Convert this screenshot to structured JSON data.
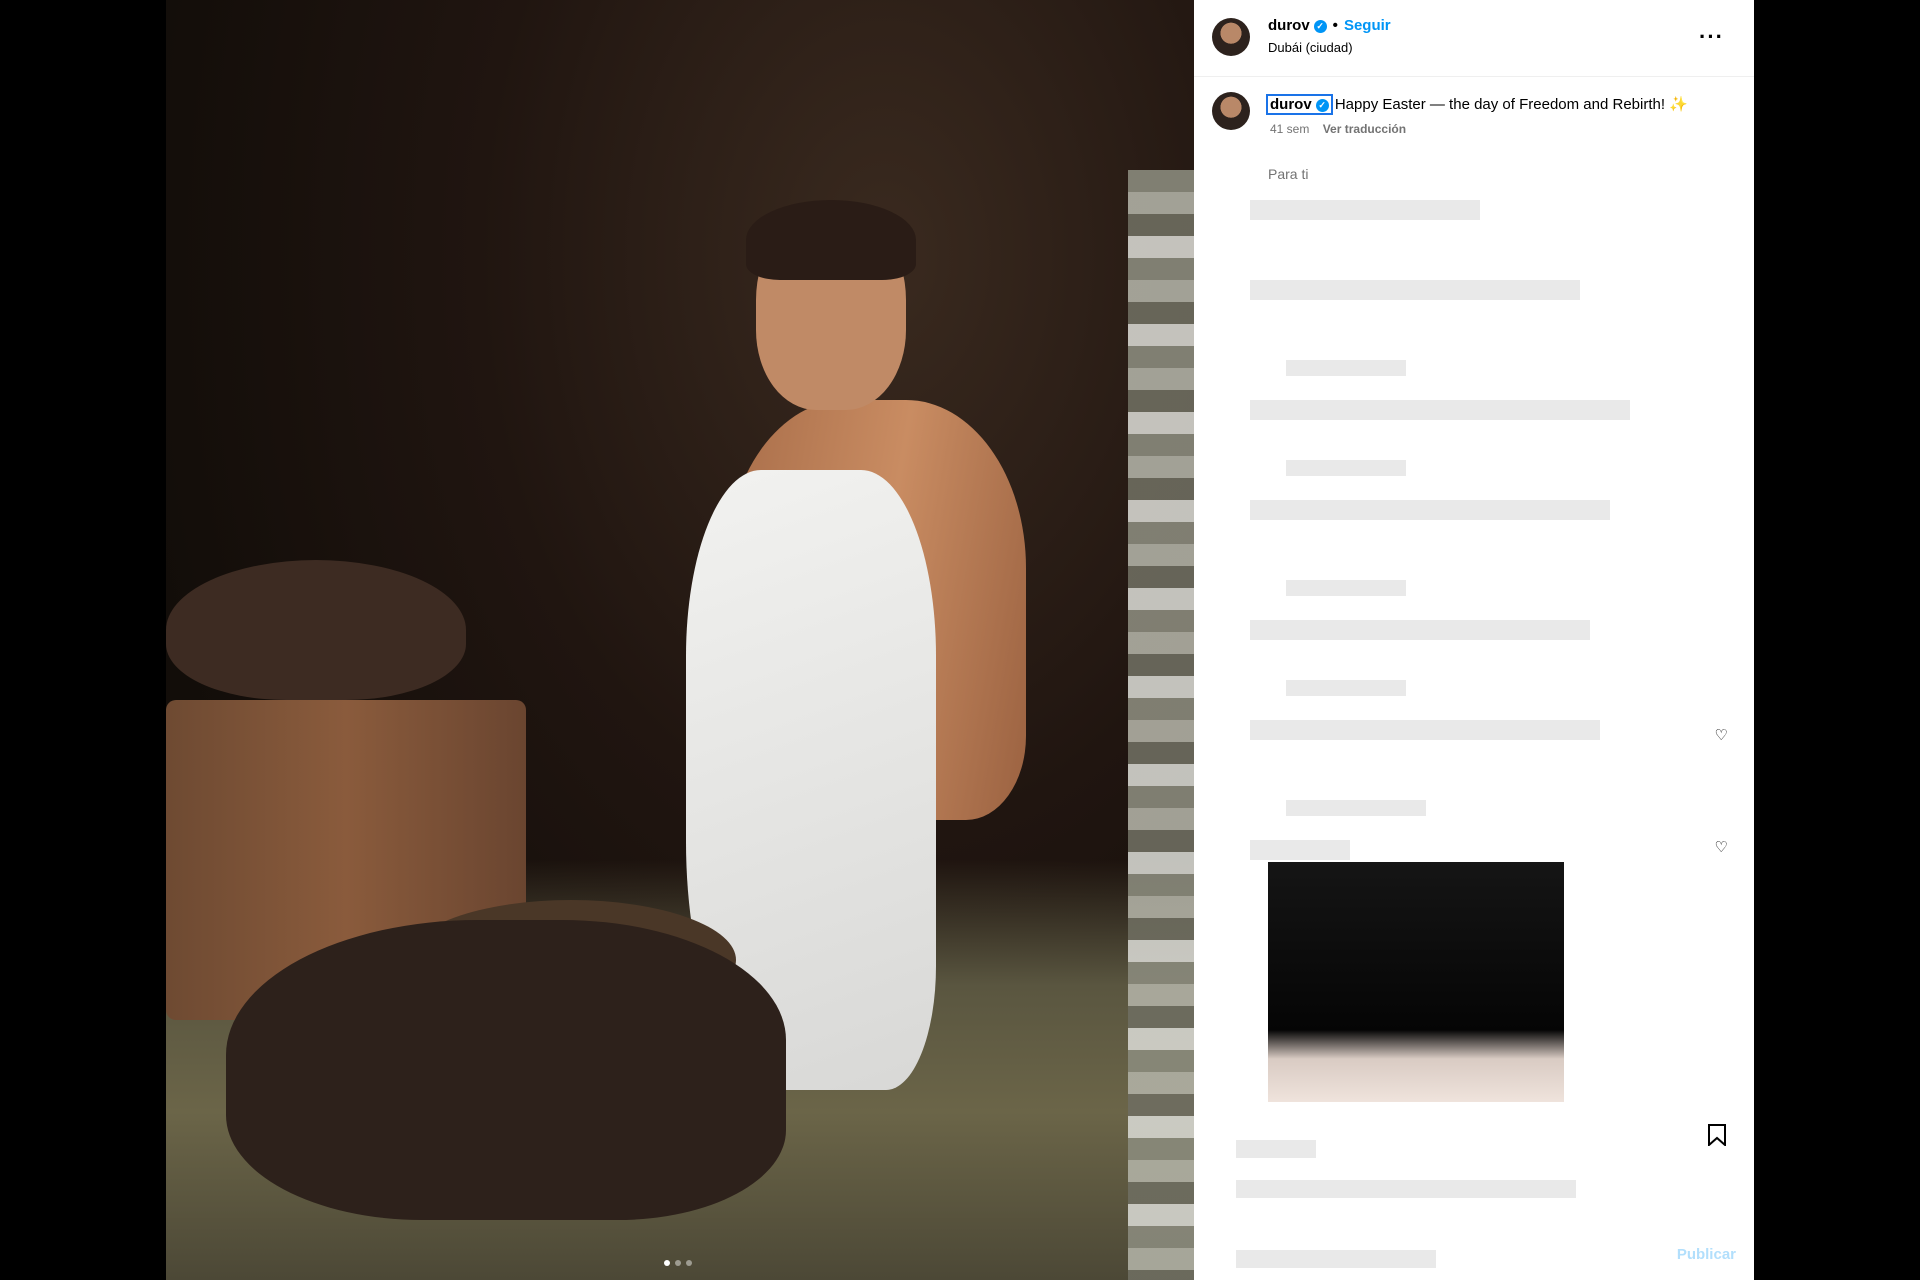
{
  "post": {
    "username": "durov",
    "follow_label": "Seguir",
    "separator": "•",
    "location": "Dubái (ciudad)",
    "more_label": "···",
    "caption": "Happy Easter — the day of Freedom and Rebirth!",
    "caption_emoji": "✨",
    "age": "41 sem",
    "translate_label": "Ver traducción",
    "for_you_label": "Para ti",
    "publish_label": "Publicar",
    "carousel": {
      "count": 3,
      "active_index": 0
    }
  },
  "colors": {
    "accent": "#0095f6",
    "publish_disabled": "#b2dffc"
  },
  "icons": {
    "verified": "verified-badge-icon",
    "heart": "heart-icon",
    "bookmark": "bookmark-icon",
    "more": "more-options-icon"
  }
}
